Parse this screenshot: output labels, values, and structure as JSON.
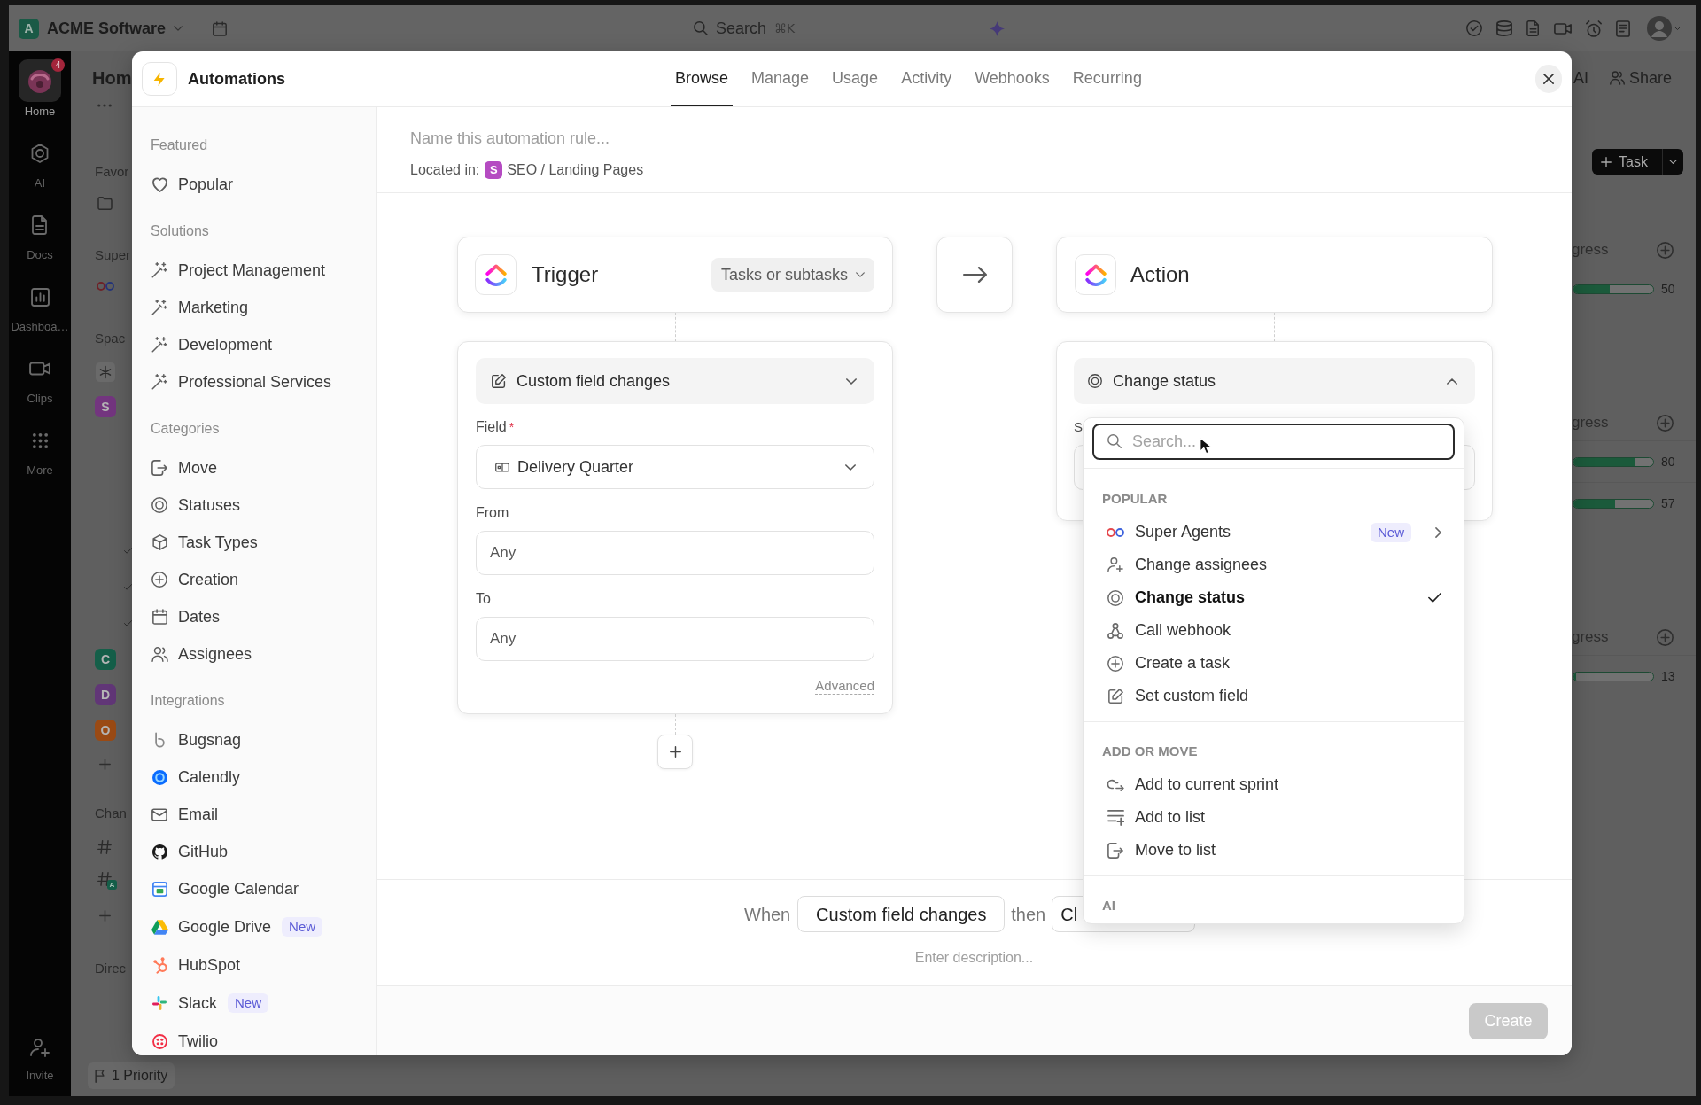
{
  "app": {
    "topbar": {
      "workspace_logo": "A",
      "workspace_name": "ACME Software",
      "search_label": "Search",
      "search_shortcut": "⌘K"
    },
    "rail": {
      "items": [
        {
          "label": "Home",
          "badge": "4",
          "selected": true
        },
        {
          "label": "AI",
          "selected": false
        },
        {
          "label": "Docs",
          "selected": false
        },
        {
          "label": "Dashboa…",
          "selected": false
        },
        {
          "label": "Clips",
          "selected": false
        },
        {
          "label": "More",
          "selected": false
        }
      ],
      "invite": "Invite"
    },
    "sidebar": {
      "title": "Hom",
      "favorites_heading": "Favor",
      "agents_heading": "Super",
      "spaces_heading": "Spac",
      "spaces": [
        {
          "letter": "S",
          "color": "#73357f"
        },
        {
          "letter": "C",
          "color": "#155f49"
        },
        {
          "letter": "D",
          "color": "#613677"
        },
        {
          "letter": "O",
          "color": "#9a4a14"
        }
      ],
      "channels_heading": "Chan",
      "channel_badge": "A",
      "direct_heading": "Direc",
      "footer": "1 Priority"
    },
    "header_actions": {
      "ai": "AI",
      "share": "Share",
      "task_button": "Task"
    },
    "progress_groups": [
      {
        "heading": "gress",
        "rows": [
          {
            "level": 0.45,
            "reading": "50"
          }
        ]
      },
      {
        "heading": "gress",
        "rows": [
          {
            "level": 0.78,
            "reading": "80"
          },
          {
            "level": 0.52,
            "reading": "57"
          }
        ]
      },
      {
        "heading": "gress",
        "rows": [
          {
            "level": 0.03,
            "reading": "13"
          }
        ]
      }
    ]
  },
  "modal": {
    "title": "Automations",
    "tabs": [
      {
        "label": "Browse",
        "selected": true
      },
      {
        "label": "Manage",
        "selected": false
      },
      {
        "label": "Usage",
        "selected": false
      },
      {
        "label": "Activity",
        "selected": false
      },
      {
        "label": "Webhooks",
        "selected": false
      },
      {
        "label": "Recurring",
        "selected": false
      }
    ],
    "sidebar": [
      {
        "heading": "Featured",
        "items": [
          {
            "label": "Popular"
          }
        ]
      },
      {
        "heading": "Solutions",
        "items": [
          {
            "label": "Project Management"
          },
          {
            "label": "Marketing"
          },
          {
            "label": "Development"
          },
          {
            "label": "Professional Services"
          }
        ]
      },
      {
        "heading": "Categories",
        "items": [
          {
            "label": "Move"
          },
          {
            "label": "Statuses"
          },
          {
            "label": "Task Types"
          },
          {
            "label": "Creation"
          },
          {
            "label": "Dates"
          },
          {
            "label": "Assignees"
          }
        ]
      },
      {
        "heading": "Integrations",
        "items": [
          {
            "label": "Bugsnag"
          },
          {
            "label": "Calendly"
          },
          {
            "label": "Email"
          },
          {
            "label": "GitHub"
          },
          {
            "label": "Google Calendar"
          },
          {
            "label": "Google Drive",
            "badge": "New"
          },
          {
            "label": "HubSpot"
          },
          {
            "label": "Slack",
            "badge": "New"
          },
          {
            "label": "Twilio"
          }
        ]
      }
    ],
    "rule": {
      "name_placeholder": "Name this automation rule...",
      "location_label": "Located in:",
      "location_badge": "S",
      "location_path": "SEO / Landing Pages"
    },
    "trigger": {
      "title": "Trigger",
      "scope": "Tasks or subtasks",
      "event": "Custom field changes",
      "expanded": false,
      "fields": [
        {
          "kind": "select",
          "label": "Field",
          "required_mark": "*",
          "value": "Delivery Quarter"
        },
        {
          "kind": "input",
          "label": "From",
          "value": "Any"
        },
        {
          "kind": "input",
          "label": "To",
          "value": "Any"
        }
      ],
      "advanced": "Advanced"
    },
    "action": {
      "title": "Action",
      "event": "Change status",
      "expanded": true,
      "field_label": "S"
    },
    "summary": {
      "when": "When",
      "trigger": "Custom field changes",
      "then": "then",
      "action": "Cl"
    },
    "description_placeholder": "Enter description...",
    "create_button": {
      "label": "Create",
      "disabled": true
    },
    "action_menu": {
      "search_placeholder": "Search...",
      "groups": [
        {
          "heading": "POPULAR",
          "items": [
            {
              "label": "Super Agents",
              "badge": "New",
              "submenu": true,
              "selected": false
            },
            {
              "label": "Change assignees",
              "submenu": false,
              "selected": false
            },
            {
              "label": "Change status",
              "submenu": false,
              "selected": true
            },
            {
              "label": "Call webhook",
              "submenu": false,
              "selected": false
            },
            {
              "label": "Create a task",
              "submenu": false,
              "selected": false
            },
            {
              "label": "Set custom field",
              "submenu": false,
              "selected": false
            }
          ]
        },
        {
          "heading": "ADD OR MOVE",
          "items": [
            {
              "label": "Add to current sprint",
              "submenu": false,
              "selected": false
            },
            {
              "label": "Add to list",
              "submenu": false,
              "selected": false
            },
            {
              "label": "Move to list",
              "submenu": false,
              "selected": false
            }
          ]
        },
        {
          "heading": "AI"
        }
      ]
    }
  }
}
